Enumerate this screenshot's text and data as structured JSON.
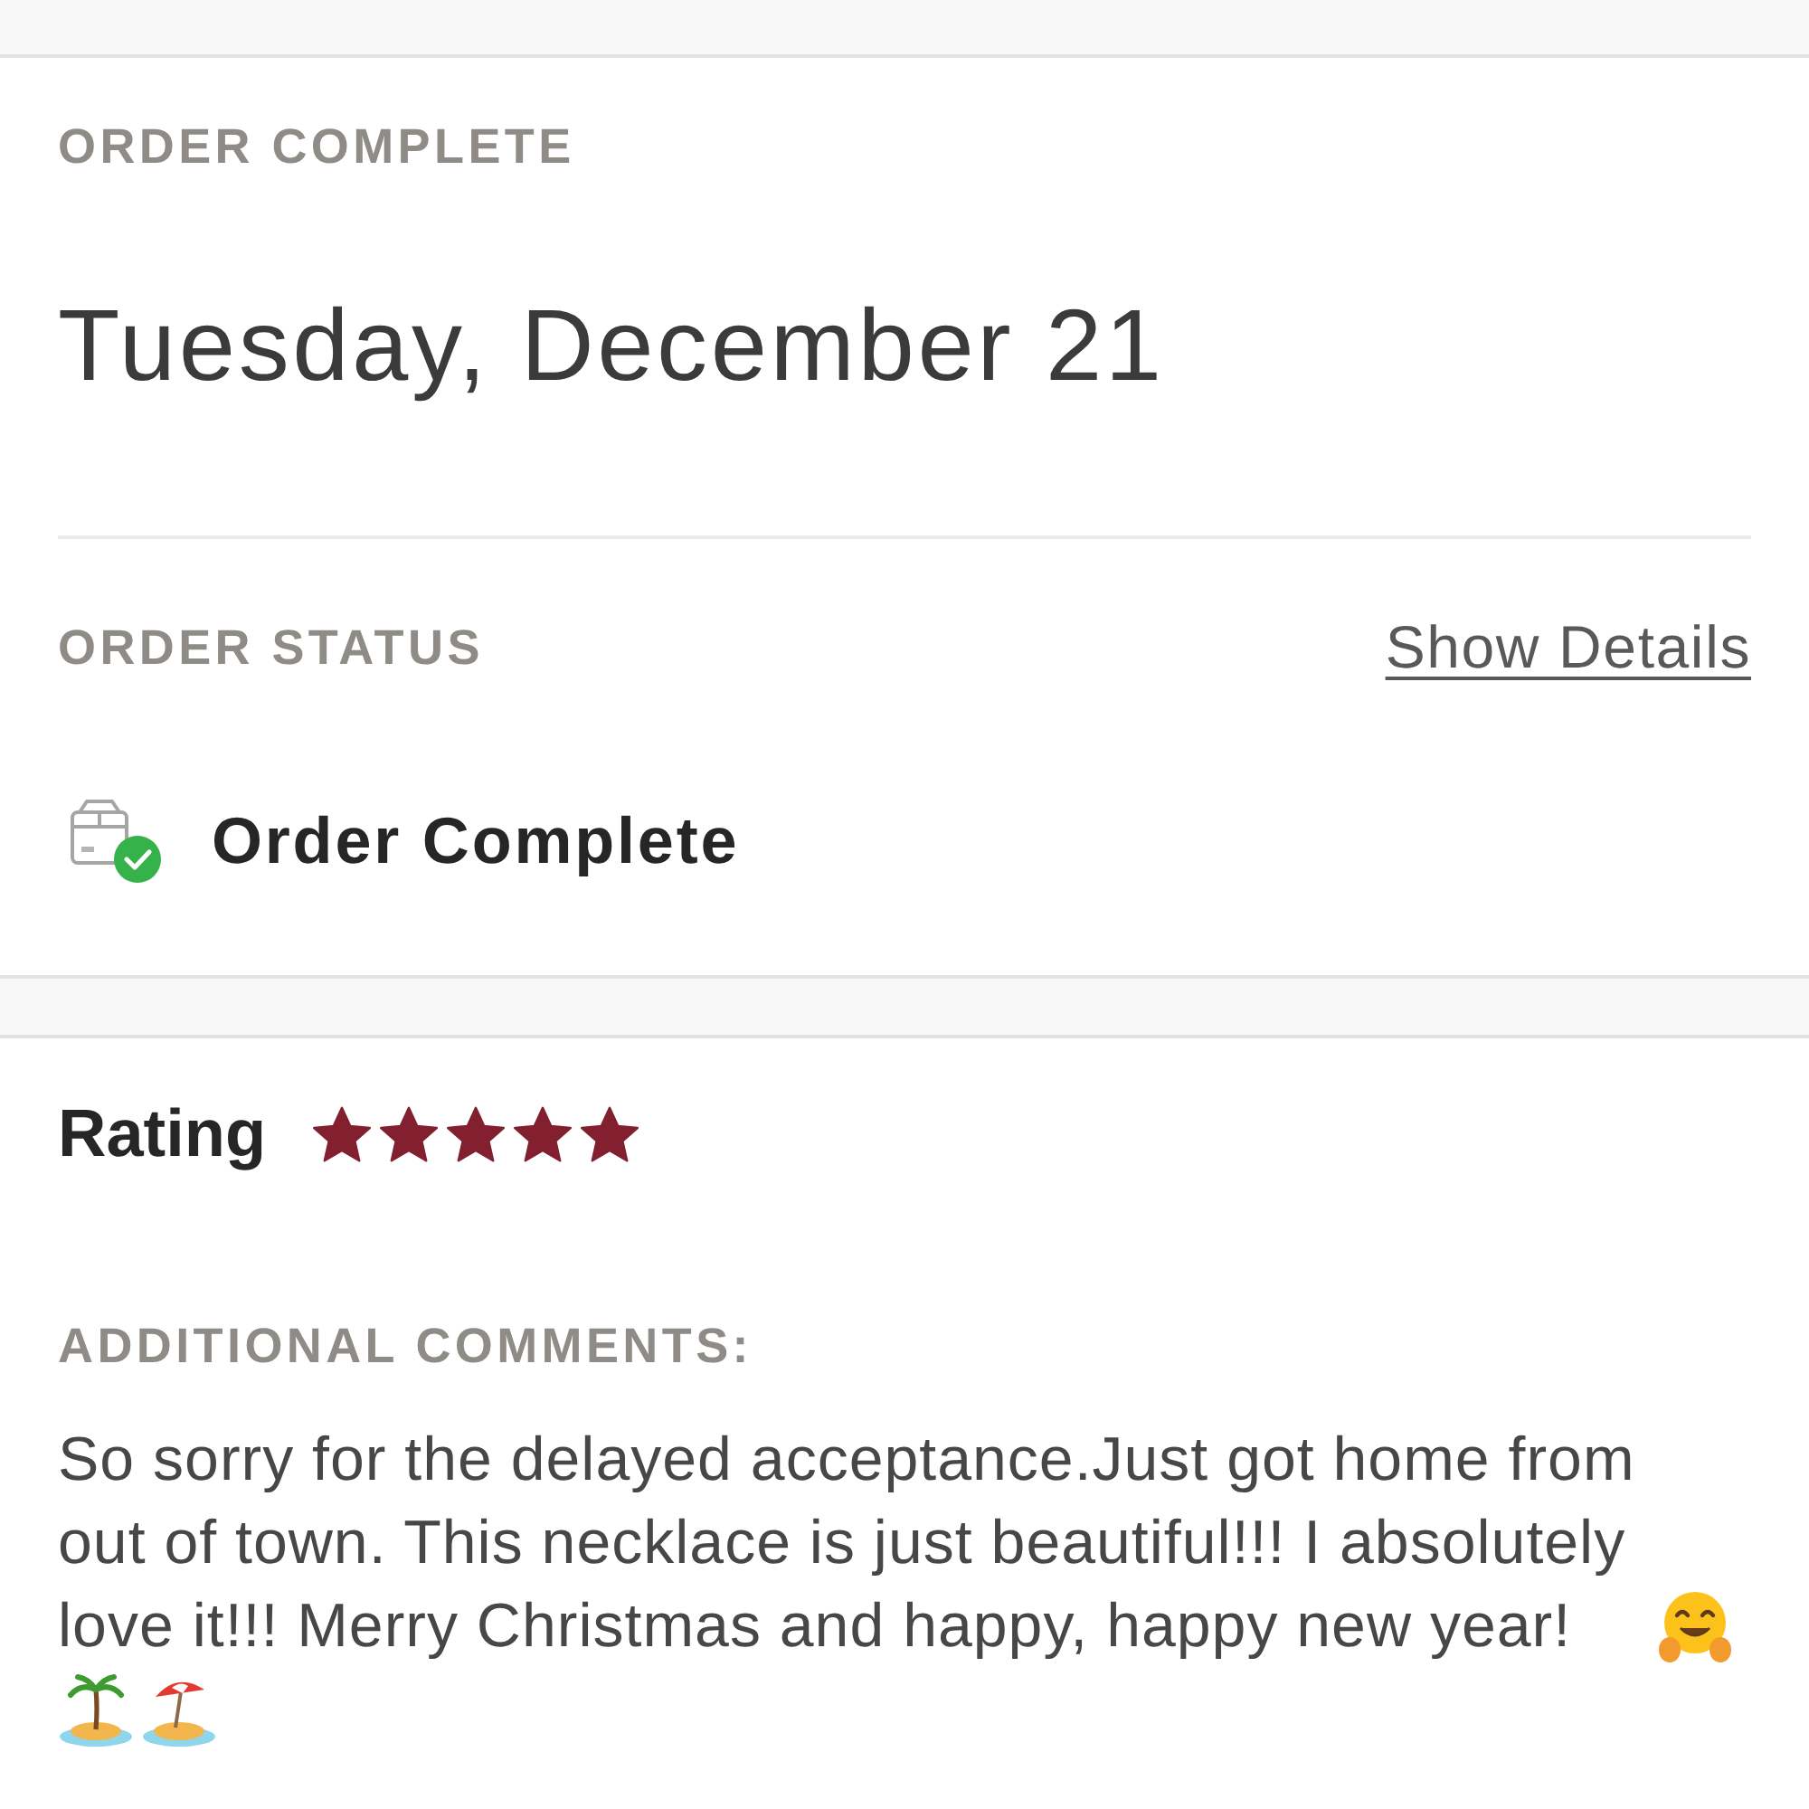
{
  "header": {
    "label": "ORDER COMPLETE",
    "date": "Tuesday, December 21"
  },
  "status": {
    "label": "ORDER STATUS",
    "link": "Show Details",
    "state": "Order Complete",
    "complete": true
  },
  "review": {
    "label": "Rating",
    "stars": 5,
    "comments_label": "ADDITIONAL COMMENTS:",
    "comment": "So sorry for the delayed acceptance.Just got home from out of town. This necklace is just beautiful!!! I absolutely love it!!! Merry Christmas and happy, happy new year!"
  }
}
